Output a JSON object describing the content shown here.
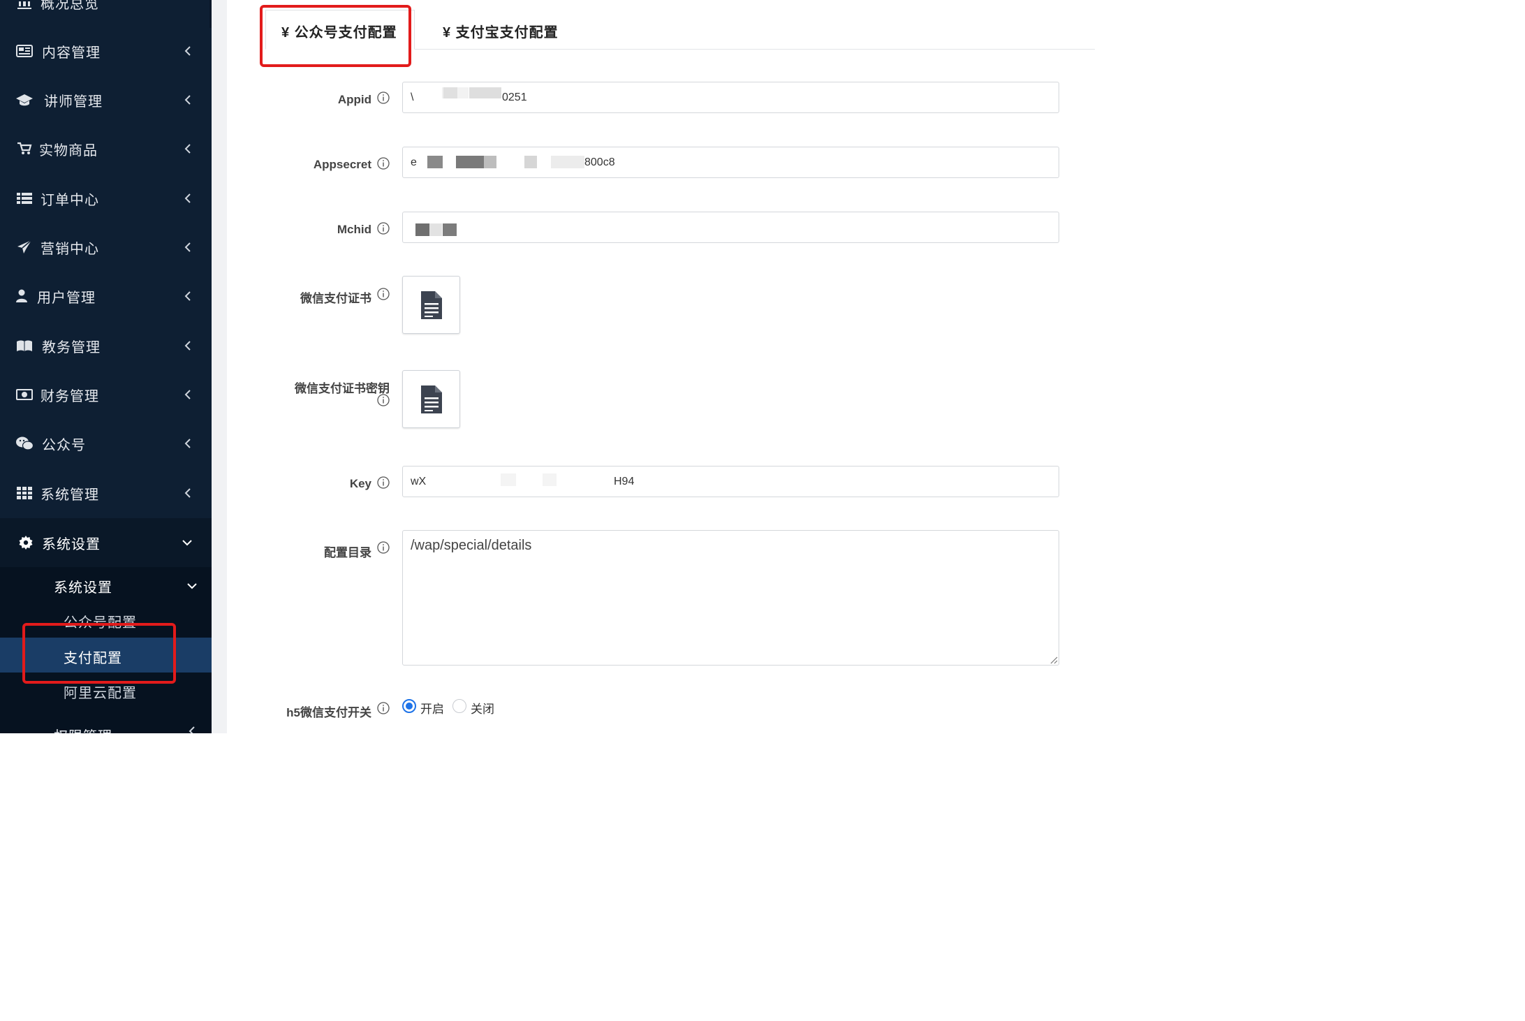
{
  "sidebar": {
    "items": [
      {
        "label": "概况总览",
        "icon": "bank-icon"
      },
      {
        "label": "内容管理",
        "icon": "newspaper-icon"
      },
      {
        "label": "讲师管理",
        "icon": "graduation-cap-icon"
      },
      {
        "label": "实物商品",
        "icon": "cart-icon"
      },
      {
        "label": "订单中心",
        "icon": "list-icon"
      },
      {
        "label": "营销中心",
        "icon": "paper-plane-icon"
      },
      {
        "label": "用户管理",
        "icon": "user-icon"
      },
      {
        "label": "教务管理",
        "icon": "book-icon"
      },
      {
        "label": "财务管理",
        "icon": "money-icon"
      },
      {
        "label": "公众号",
        "icon": "wechat-icon"
      },
      {
        "label": "系统管理",
        "icon": "grid-icon"
      },
      {
        "label": "系统设置",
        "icon": "gear-icon"
      }
    ],
    "submenu_title": "系统设置",
    "sub_items": [
      "公众号配置",
      "支付配置",
      "阿里云配置"
    ],
    "bottom_item": "权限管理"
  },
  "tabs": [
    {
      "label": "¥ 公众号支付配置",
      "active": true
    },
    {
      "label": "¥ 支付宝支付配置",
      "active": false
    }
  ],
  "form": {
    "appid": {
      "label": "Appid",
      "value_start": "\\",
      "value_end": "0251"
    },
    "appsecret": {
      "label": "Appsecret",
      "value_start": "e",
      "value_end": "800c8"
    },
    "mchid": {
      "label": "Mchid",
      "value": ""
    },
    "cert": {
      "label": "微信支付证书"
    },
    "cert_key": {
      "label": "微信支付证书密钥"
    },
    "key": {
      "label": "Key",
      "value_start": "wX",
      "value_end": "H94"
    },
    "config_dir": {
      "label": "配置目录",
      "value": "/wap/special/details"
    },
    "h5_switch": {
      "label": "h5微信支付开关",
      "on_label": "开启",
      "off_label": "关闭",
      "selected": "on"
    }
  },
  "colors": {
    "sidebar_bg": "#0e1f33",
    "active_bg": "#1a3d66",
    "highlight_red": "#e21b1b",
    "radio_blue": "#1e73e8"
  }
}
